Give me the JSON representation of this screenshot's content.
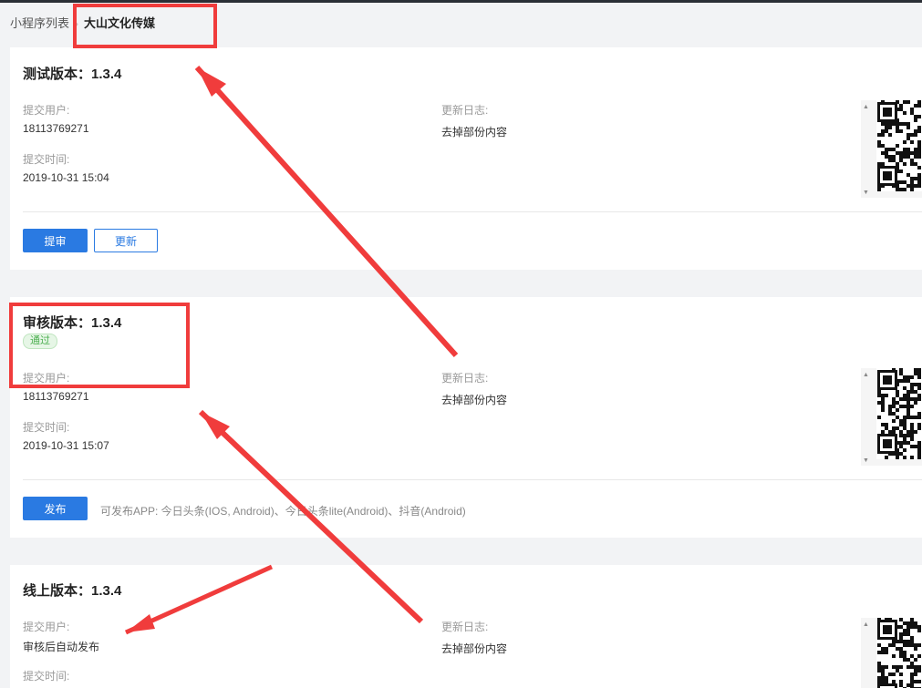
{
  "breadcrumb": {
    "parent": "小程序列表",
    "separator": "›",
    "current": "大山文化传媒"
  },
  "cards": {
    "test": {
      "title": "测试版本：1.3.4",
      "submitter_label": "提交用户:",
      "submitter": "18113769271",
      "time_label": "提交时间:",
      "time": "2019-10-31 15:04",
      "log_label": "更新日志:",
      "log": "去掉部份内容",
      "btn_review": "提审",
      "btn_update": "更新"
    },
    "audit": {
      "title": "审核版本：1.3.4",
      "status": "通过",
      "submitter_label": "提交用户:",
      "submitter": "18113769271",
      "time_label": "提交时间:",
      "time": "2019-10-31 15:07",
      "log_label": "更新日志:",
      "log": "去掉部份内容",
      "btn_publish": "发布",
      "publish_note": "可发布APP: 今日头条(IOS, Android)、今日头条lite(Android)、抖音(Android)"
    },
    "online": {
      "title": "线上版本：1.3.4",
      "submitter_label": "提交用户:",
      "submitter": "审核后自动发布",
      "time_label": "提交时间:",
      "log_label": "更新日志:",
      "log": "去掉部份内容"
    }
  },
  "colors": {
    "accent": "#2a7ae2",
    "annotation_red": "#f03c3c",
    "success_green": "#4caf50"
  },
  "icons": {
    "scroll_up": "▲",
    "scroll_down": "▼"
  }
}
